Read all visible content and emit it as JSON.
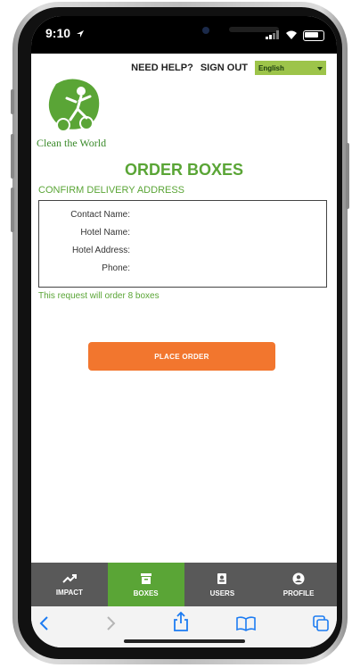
{
  "status": {
    "time": "9:10"
  },
  "nav": {
    "need_help": "NEED HELP?",
    "sign_out": "SIGN OUT",
    "language": "English"
  },
  "brand": {
    "logo_text": "Clean the World"
  },
  "page": {
    "title": "ORDER BOXES",
    "subtitle": "CONFIRM DELIVERY ADDRESS",
    "fields": [
      {
        "label": "Contact Name:",
        "value": ""
      },
      {
        "label": "Hotel Name:",
        "value": ""
      },
      {
        "label": "Hotel Address:",
        "value": ""
      },
      {
        "label": "Phone:",
        "value": ""
      }
    ],
    "note": "This request will order 8 boxes",
    "place_order": "PLACE ORDER"
  },
  "tabs": [
    {
      "label": "IMPACT",
      "icon": "trend-icon",
      "active": false
    },
    {
      "label": "BOXES",
      "icon": "box-icon",
      "active": true
    },
    {
      "label": "USERS",
      "icon": "contacts-icon",
      "active": false
    },
    {
      "label": "PROFILE",
      "icon": "person-icon",
      "active": false
    }
  ],
  "colors": {
    "brand_green": "#5aa536",
    "order_button": "#f2762e",
    "tabbar": "#595959",
    "lang_select": "#9dc44a"
  }
}
